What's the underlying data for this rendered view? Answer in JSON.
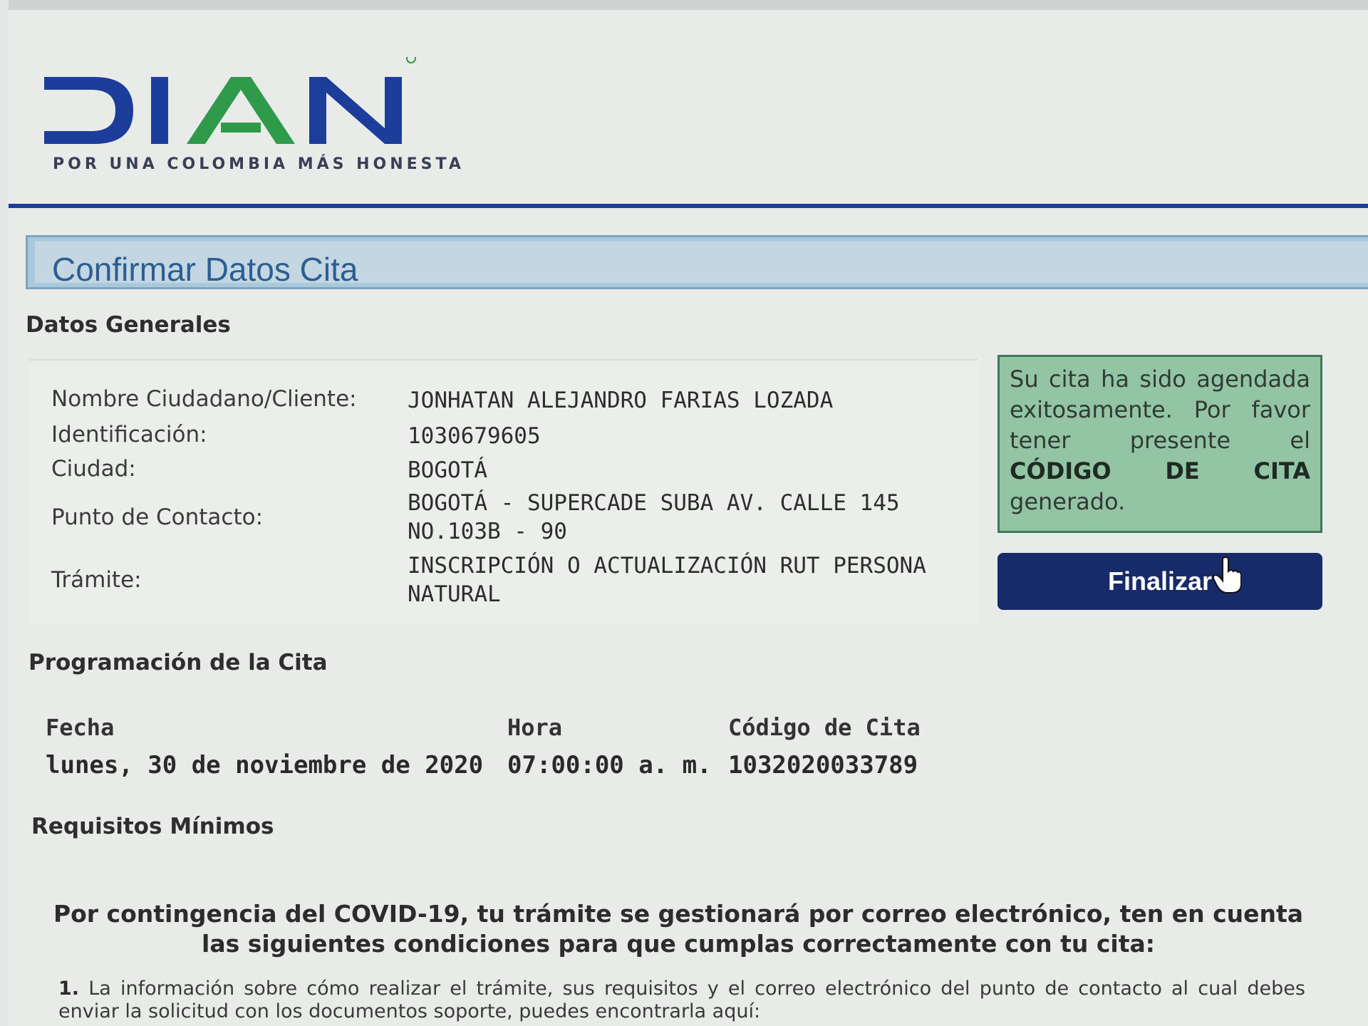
{
  "brand": {
    "logo_text": "DIAN",
    "tagline": "POR UNA COLOMBIA MÁS HONESTA",
    "colors": {
      "blue": "#1c3e9a",
      "green": "#2f9a4a"
    }
  },
  "page_title": "Confirmar Datos Cita",
  "datos_generales": {
    "heading": "Datos Generales",
    "fields": [
      {
        "label": "Nombre Ciudadano/Cliente:",
        "value": "JONHATAN ALEJANDRO FARIAS LOZADA"
      },
      {
        "label": "Identificación:",
        "value": "1030679605"
      },
      {
        "label": "Ciudad:",
        "value": "BOGOTÁ"
      },
      {
        "label": "Punto de Contacto:",
        "value": "BOGOTÁ - SUPERCADE SUBA AV. CALLE 145 NO.103B - 90"
      },
      {
        "label": "Trámite:",
        "value": "INSCRIPCIÓN O ACTUALIZACIÓN RUT PERSONA NATURAL"
      }
    ]
  },
  "success_message": {
    "text_before": "Su cita ha sido agendada exitosamente. Por favor tener presente el ",
    "emphasis": "CÓDIGO DE CITA",
    "text_after": " generado."
  },
  "finalizar_button": "Finalizar",
  "programacion": {
    "heading": "Programación de la Cita",
    "fecha_label": "Fecha",
    "fecha_value": "lunes, 30 de noviembre de 2020",
    "hora_label": "Hora",
    "hora_value": "07:00:00 a. m.",
    "codigo_label": "Código de Cita",
    "codigo_value": "1032020033789"
  },
  "requisitos": {
    "heading": "Requisitos Mínimos",
    "covid_notice": "Por contingencia del COVID-19, tu trámite se gestionará por correo electrónico, ten en cuenta las siguientes condiciones para que cumplas correctamente con tu cita:",
    "item_number": "1.",
    "item_text": "La información sobre cómo realizar el trámite, sus requisitos y el correo electrónico del punto de contacto al cual debes enviar la solicitud con los documentos soporte, puedes encontrarla aquí:"
  }
}
